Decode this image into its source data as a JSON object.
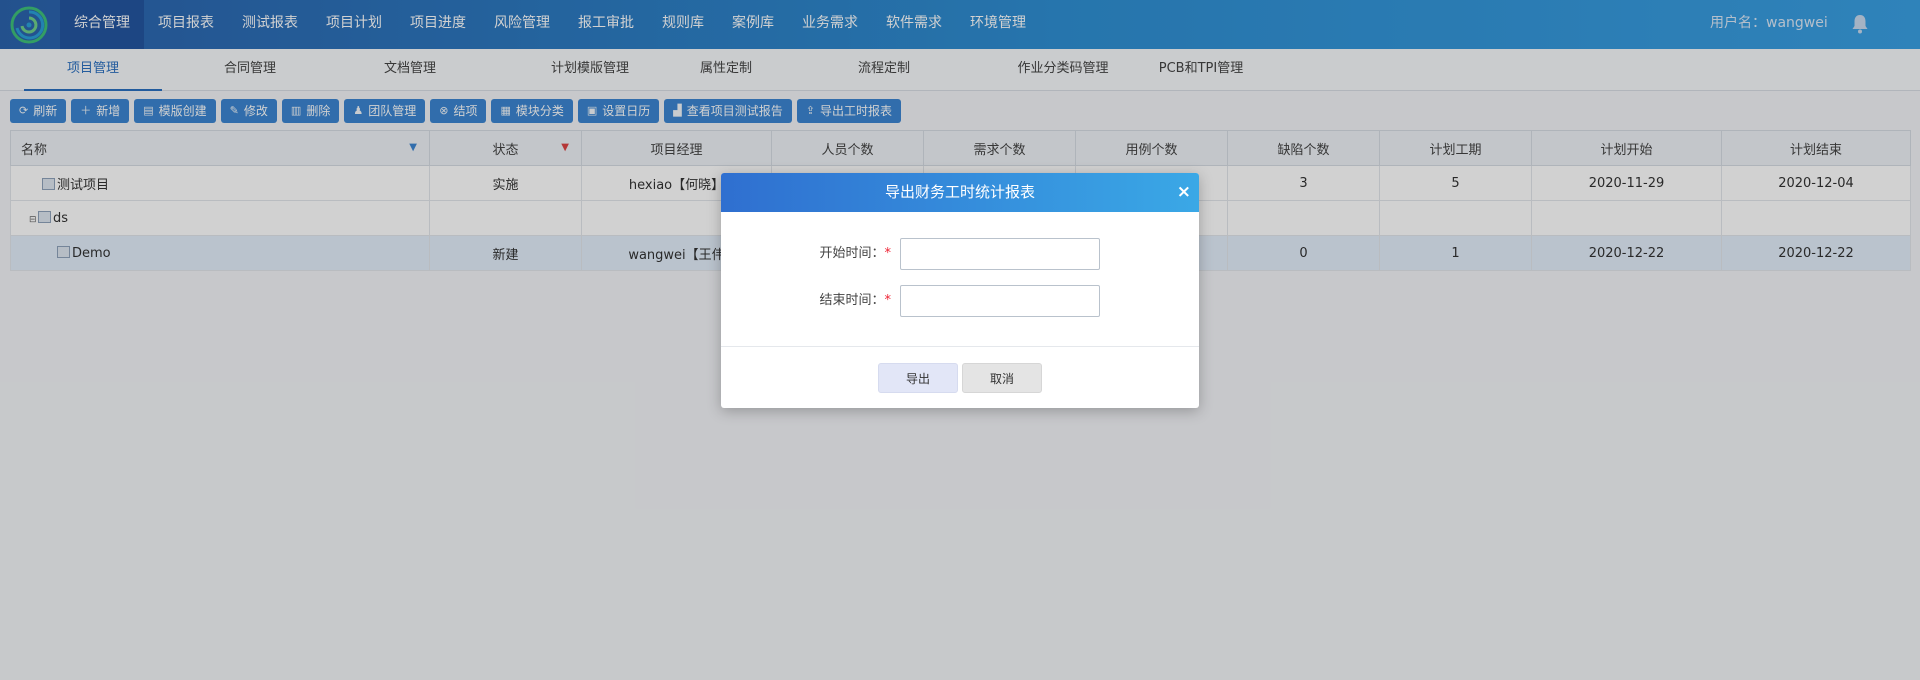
{
  "nav": {
    "items": [
      "综合管理",
      "项目报表",
      "测试报表",
      "项目计划",
      "项目进度",
      "风险管理",
      "报工审批",
      "规则库",
      "案例库",
      "业务需求",
      "软件需求",
      "环境管理"
    ],
    "user": "用户名：wangwei"
  },
  "subtabs": [
    "项目管理",
    "合同管理",
    "文档管理",
    "计划模版管理",
    "属性定制",
    "流程定制",
    "作业分类码管理",
    "PCB和TPI管理"
  ],
  "toolbar": [
    {
      "icon": "refresh-icon",
      "label": "刷新"
    },
    {
      "icon": "plus-icon",
      "label": "新增"
    },
    {
      "icon": "template-icon",
      "label": "模版创建"
    },
    {
      "icon": "edit-icon",
      "label": "修改"
    },
    {
      "icon": "trash-icon",
      "label": "删除"
    },
    {
      "icon": "team-icon",
      "label": "团队管理"
    },
    {
      "icon": "close-circle-icon",
      "label": "结项"
    },
    {
      "icon": "grid-icon",
      "label": "模块分类"
    },
    {
      "icon": "calendar-icon",
      "label": "设置日历"
    },
    {
      "icon": "bar-chart-icon",
      "label": "查看项目测试报告"
    },
    {
      "icon": "export-icon",
      "label": "导出工时报表"
    }
  ],
  "grid": {
    "headers": [
      "名称",
      "状态",
      "项目经理",
      "人员个数",
      "需求个数",
      "用例个数",
      "缺陷个数",
      "计划工期",
      "计划开始",
      "计划结束"
    ],
    "rows": [
      {
        "name": "测试项目",
        "status": "实施",
        "manager": "hexiao【何晓】",
        "people": "",
        "req": "",
        "cases": "",
        "defects": "3",
        "duration": "5",
        "start": "2020-11-29",
        "end": "2020-12-04"
      },
      {
        "name": "ds",
        "status": "",
        "manager": "",
        "people": "",
        "req": "",
        "cases": "",
        "defects": "",
        "duration": "",
        "start": "",
        "end": ""
      },
      {
        "name": "Demo",
        "status": "新建",
        "manager": "wangwei【王伟",
        "people": "",
        "req": "",
        "cases": "",
        "defects": "0",
        "duration": "1",
        "start": "2020-12-22",
        "end": "2020-12-22"
      }
    ]
  },
  "dialog": {
    "title": "导出财务工时统计报表",
    "close": "×",
    "start_label": "开始时间：",
    "end_label": "结束时间：",
    "required": "*",
    "start_value": "",
    "end_value": "",
    "ok": "导出",
    "cancel": "取消"
  }
}
